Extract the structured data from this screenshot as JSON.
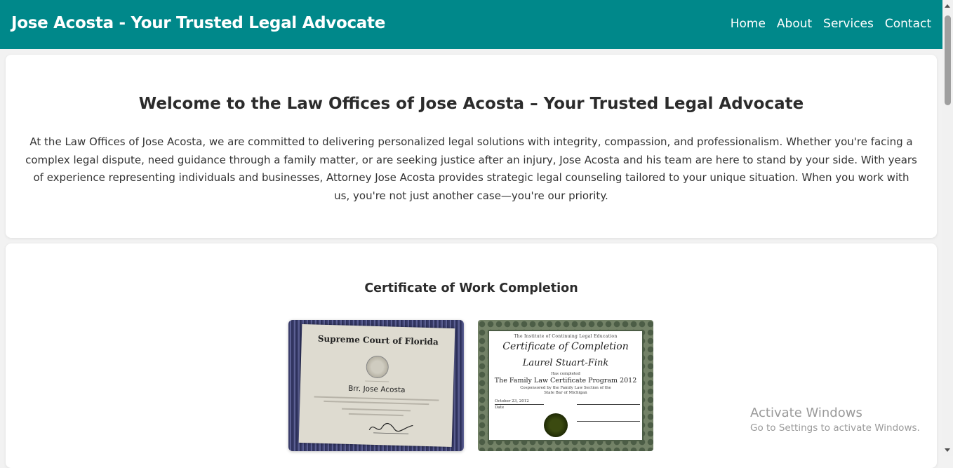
{
  "header": {
    "title": "Jose Acosta - Your Trusted Legal Advocate",
    "nav": [
      "Home",
      "About",
      "Services",
      "Contact"
    ],
    "bg_color": "#00888a"
  },
  "intro": {
    "heading": "Welcome to the Law Offices of Jose Acosta – Your Trusted Legal Advocate",
    "body": "At the Law Offices of Jose Acosta, we are committed to delivering personalized legal solutions with integrity, compassion, and professionalism. Whether you're facing a complex legal dispute, need guidance through a family matter, or are seeking justice after an injury, Jose Acosta and his team are here to stand by your side. With years of experience representing individuals and businesses, Attorney Jose Acosta provides strategic legal counseling tailored to your unique situation. When you work with us, you're not just another case—you're our priority."
  },
  "certificates": {
    "heading": "Certificate of Work Completion",
    "florida": {
      "title": "Supreme Court of Florida",
      "name": "Brr. Jose Acosta"
    },
    "michigan": {
      "institute": "The Institute of Continuing Legal Education",
      "title": "Certificate of Completion",
      "name": "Laurel Stuart-Fink",
      "has_completed": "Has completed",
      "program": "The Family Law Certificate Program 2012",
      "cosponsor": "Cosponsored by the Family Law Section of the",
      "bar": "State Bar of Michigan",
      "date": "October 23, 2012",
      "date_label": "Date"
    }
  },
  "watermark": {
    "line1": "Activate Windows",
    "line2": "Go to Settings to activate Windows."
  }
}
